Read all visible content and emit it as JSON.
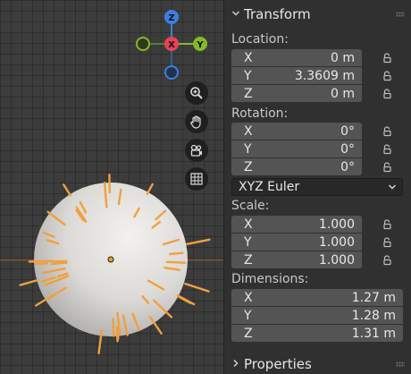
{
  "viewport": {
    "gizmo": {
      "z_label": "Z",
      "x_label": "X",
      "y_label": "Y"
    },
    "tools": [
      {
        "name": "zoom-icon",
        "glyph": "⊕"
      },
      {
        "name": "hand-pan-icon",
        "glyph": "✋"
      },
      {
        "name": "camera-icon",
        "glyph": "◉"
      },
      {
        "name": "grid-icon",
        "glyph": "▦"
      }
    ],
    "colors": {
      "x_axis": "#e84357",
      "y_axis": "#84b82b",
      "z_axis": "#3d7fe0",
      "normals": "#f0a040",
      "sphere": "#d7d6d3"
    }
  },
  "transform": {
    "header": "Transform",
    "location": {
      "label": "Location:",
      "x": {
        "axis": "X",
        "value": "0 m"
      },
      "y": {
        "axis": "Y",
        "value": "3.3609 m"
      },
      "z": {
        "axis": "Z",
        "value": "0 m"
      }
    },
    "rotation": {
      "label": "Rotation:",
      "x": {
        "axis": "X",
        "value": "0°"
      },
      "y": {
        "axis": "Y",
        "value": "0°"
      },
      "z": {
        "axis": "Z",
        "value": "0°"
      }
    },
    "rotation_mode": {
      "selected": "XYZ Euler"
    },
    "scale": {
      "label": "Scale:",
      "x": {
        "axis": "X",
        "value": "1.000"
      },
      "y": {
        "axis": "Y",
        "value": "1.000"
      },
      "z": {
        "axis": "Z",
        "value": "1.000"
      }
    },
    "dimensions": {
      "label": "Dimensions:",
      "x": {
        "axis": "X",
        "value": "1.27 m"
      },
      "y": {
        "axis": "Y",
        "value": "1.28 m"
      },
      "z": {
        "axis": "Z",
        "value": "1.31 m"
      }
    }
  },
  "properties": {
    "header": "Properties"
  }
}
